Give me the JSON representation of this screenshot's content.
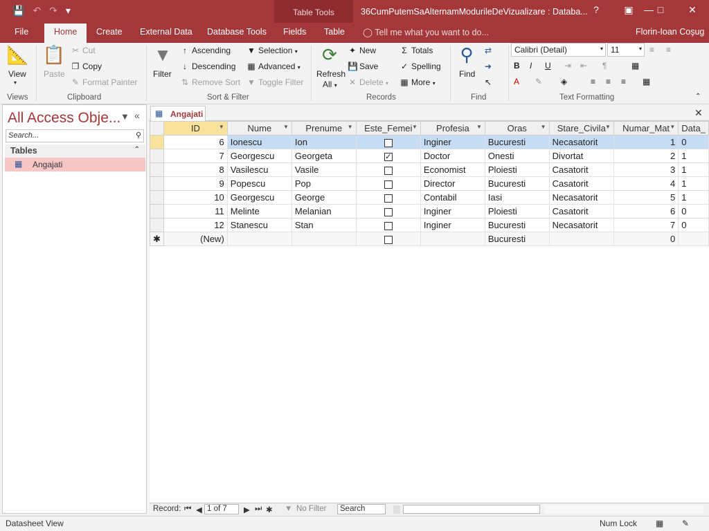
{
  "app": {
    "doc_title": "36CumPutemSaAlternamModurileDeVizualizare : Databa...",
    "contextual_label": "Table Tools",
    "user": "Florin-Ioan Coşug",
    "tell_me": "Tell me what you want to do..."
  },
  "tabs": [
    "File",
    "Home",
    "Create",
    "External Data",
    "Database Tools",
    "Fields",
    "Table"
  ],
  "ribbon": {
    "views": {
      "label": "Views",
      "view": "View"
    },
    "clipboard": {
      "label": "Clipboard",
      "paste": "Paste",
      "cut": "Cut",
      "copy": "Copy",
      "format_painter": "Format Painter"
    },
    "sort_filter": {
      "label": "Sort & Filter",
      "filter": "Filter",
      "ascending": "Ascending",
      "descending": "Descending",
      "remove_sort": "Remove Sort",
      "selection": "Selection",
      "advanced": "Advanced",
      "toggle_filter": "Toggle Filter"
    },
    "records": {
      "label": "Records",
      "refresh": "Refresh",
      "refresh_all": "All",
      "new": "New",
      "save": "Save",
      "delete": "Delete",
      "totals": "Totals",
      "spelling": "Spelling",
      "more": "More"
    },
    "find": {
      "label": "Find",
      "find": "Find"
    },
    "text_formatting": {
      "label": "Text Formatting",
      "font": "Calibri (Detail)",
      "size": "11"
    }
  },
  "nav": {
    "title": "All Access Obje...",
    "search_placeholder": "Search...",
    "section": "Tables",
    "items": [
      "Angajati"
    ]
  },
  "doc_tab": "Angajati",
  "grid": {
    "columns": [
      "ID",
      "Nume",
      "Prenume",
      "Este_Femei",
      "Profesia",
      "Oras",
      "Stare_Civila",
      "Numar_Mat",
      "Data_"
    ],
    "rows": [
      {
        "id": "6",
        "nume": "Ionescu",
        "prenume": "Ion",
        "femeie": false,
        "profesia": "Inginer",
        "oras": "Bucuresti",
        "stare": "Necasatorit",
        "nr": "1",
        "data": "0"
      },
      {
        "id": "7",
        "nume": "Georgescu",
        "prenume": "Georgeta",
        "femeie": true,
        "profesia": "Doctor",
        "oras": "Onesti",
        "stare": "Divortat",
        "nr": "2",
        "data": "1"
      },
      {
        "id": "8",
        "nume": "Vasilescu",
        "prenume": "Vasile",
        "femeie": false,
        "profesia": "Economist",
        "oras": "Ploiesti",
        "stare": "Casatorit",
        "nr": "3",
        "data": "1"
      },
      {
        "id": "9",
        "nume": "Popescu",
        "prenume": "Pop",
        "femeie": false,
        "profesia": "Director",
        "oras": "Bucuresti",
        "stare": "Casatorit",
        "nr": "4",
        "data": "1"
      },
      {
        "id": "10",
        "nume": "Georgescu",
        "prenume": "George",
        "femeie": false,
        "profesia": "Contabil",
        "oras": "Iasi",
        "stare": "Necasatorit",
        "nr": "5",
        "data": "1"
      },
      {
        "id": "11",
        "nume": "Melinte",
        "prenume": "Melanian",
        "femeie": false,
        "profesia": "Inginer",
        "oras": "Ploiesti",
        "stare": "Casatorit",
        "nr": "6",
        "data": "0"
      },
      {
        "id": "12",
        "nume": "Stanescu",
        "prenume": "Stan",
        "femeie": false,
        "profesia": "Inginer",
        "oras": "Bucuresti",
        "stare": "Necasatorit",
        "nr": "7",
        "data": "0"
      }
    ],
    "new_row": {
      "id": "(New)",
      "oras": "Bucuresti",
      "nr": "0"
    }
  },
  "record_nav": {
    "label": "Record:",
    "position": "1 of 7",
    "filter": "No Filter",
    "search": "Search"
  },
  "status": {
    "view": "Datasheet View",
    "numlock": "Num Lock"
  },
  "colors": {
    "accent": "#a4373a",
    "contextual": "#8e2b2e",
    "selected_row": "#c6dcf5",
    "selected_header": "#f9e39c",
    "nav_item": "#f7c7c8"
  }
}
